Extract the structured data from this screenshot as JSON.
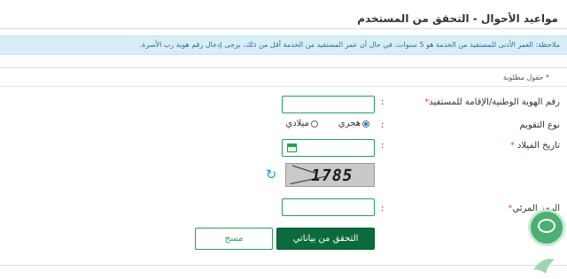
{
  "page": {
    "title": "مواعيد الأحوال - التحقق من المستخدم",
    "note": "ملاحظة: العمر الأدنى للمستفيد من الخدمة هو 5 سنوات. في حال أن عمر المستفيد من الخدمة أقل من ذلك، يرجى إدخال رقم هوية رب الأسرة.",
    "required_fields": "* حقول مطلوبة"
  },
  "form": {
    "id_label": "رقم الهوية الوطنية/الإقامة للمستفيد",
    "id_value": "",
    "calendar_label": "نوع التقويم",
    "calendar_options": [
      "هجري",
      "ميلادي"
    ],
    "calendar_selected": "هجري",
    "dob_label": "تاريخ الميلاد",
    "dob_value": "",
    "captcha_text": "1785",
    "code_label": "الرمز المرئي",
    "code_value": "",
    "colon": ":",
    "star": "*"
  },
  "buttons": {
    "verify": "التحقق من بياناتي",
    "clear": "مسح"
  },
  "icons": {
    "calendar": "calendar-icon",
    "refresh": "refresh-icon",
    "chat": "chat-icon"
  },
  "colors": {
    "primary": "#0c6b3c",
    "accent": "#2a9d5c",
    "note_bg": "#d9edf7",
    "note_text": "#31708f",
    "required": "#d9534f"
  }
}
